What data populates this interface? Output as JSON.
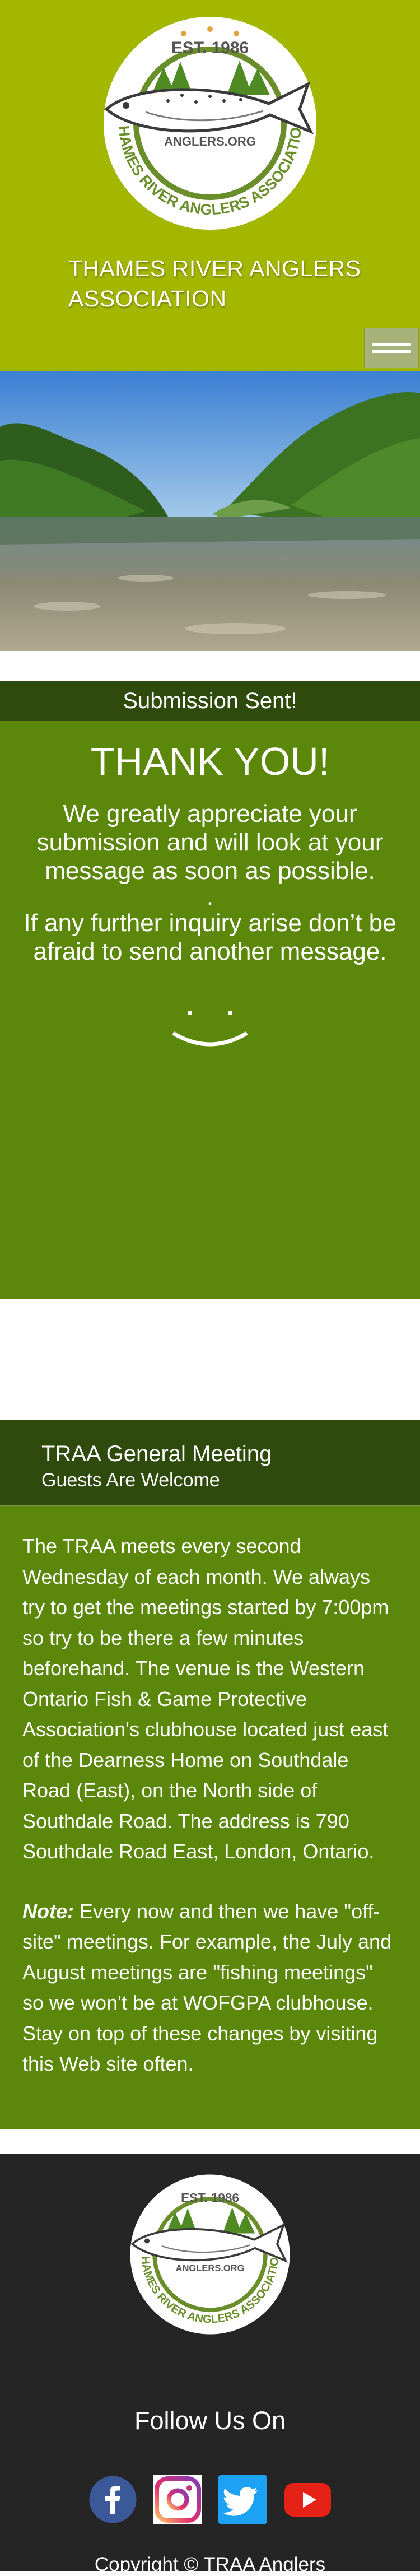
{
  "header": {
    "logo": {
      "year_text": "EST. 1986",
      "site_text": "ANGLERS.ORG",
      "ring_text": "THAMES RIVER ANGLERS ASSOCIATION"
    },
    "site_title": "THAMES RIVER ANGLERS ASSOCIATION"
  },
  "hero": {
    "alt": "River scene"
  },
  "submission": {
    "banner": "Submission Sent!",
    "heading": "THANK YOU!",
    "message_1": "We greatly appreciate your submission and will look at your message as soon as possible.",
    "separator": ".",
    "message_2": "If any further inquiry arise don’t be afraid to send another message."
  },
  "meeting": {
    "title": "TRAA General Meeting",
    "subtitle": "Guests Are Welcome",
    "paragraph_1": "The TRAA meets every second Wednesday of each month. We always try to get the meetings started by 7:00pm so try to be there a few minutes beforehand. The venue is the Western Ontario Fish & Game Protective Association's clubhouse located just east of the Dearness Home on Southdale Road (East), on the North side of Southdale Road. The address is 790 Southdale Road East, London, Ontario.",
    "note_label": "Note:",
    "note_text": "Every now and then we have \"off-site\" meetings. For example, the July and August meetings are \"fishing meetings\" so we won't be at WOFGPA clubhouse. Stay on top of these changes by visiting this Web site often."
  },
  "footer": {
    "follow_title": "Follow Us On",
    "socials": [
      {
        "name": "Facebook",
        "icon": "facebook-icon",
        "color": "#3b5998"
      },
      {
        "name": "Instagram",
        "icon": "instagram-icon",
        "color": "#c13584"
      },
      {
        "name": "Twitter",
        "icon": "twitter-icon",
        "color": "#1da1f2"
      },
      {
        "name": "YouTube",
        "icon": "youtube-icon",
        "color": "#e62117"
      }
    ],
    "copyright": "Copyright © TRAA Anglers"
  },
  "colors": {
    "header_bg": "#a3b600",
    "dark_green": "#2e4a0d",
    "green": "#5b870a",
    "footer_bg": "#252525"
  }
}
